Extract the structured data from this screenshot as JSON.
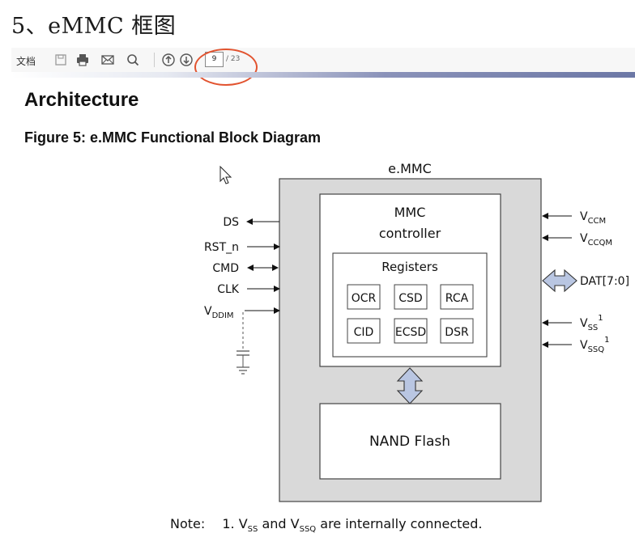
{
  "heading": "5、eMMC 框图",
  "toolbar": {
    "doc_label": "文档",
    "page_current": "9",
    "page_total": "/ 23",
    "icons": [
      "save-icon",
      "print-icon",
      "mail-icon",
      "search-icon",
      "arrow-up-circle-icon",
      "arrow-down-circle-icon"
    ]
  },
  "document": {
    "section_title": "Architecture",
    "figure_title": "Figure 5: e.MMC Functional Block Diagram",
    "diagram": {
      "outer_label": "e.MMC",
      "controller_line1": "MMC",
      "controller_line2": "controller",
      "registers_label": "Registers",
      "registers": [
        "OCR",
        "CSD",
        "RCA",
        "CID",
        "ECSD",
        "DSR"
      ],
      "nand_label": "NAND Flash",
      "left_signals": {
        "ds": "DS",
        "rst": "RST_n",
        "cmd": "CMD",
        "clk": "CLK",
        "vddim_main": "V",
        "vddim_sub": "DDIM"
      },
      "right_signals": {
        "vccm_main": "V",
        "vccm_sub": "CCM",
        "vccqm_main": "V",
        "vccqm_sub": "CCQM",
        "dat": "DAT[7:0]",
        "vss_main": "V",
        "vss_sub": "SS",
        "vss_sup": "1",
        "vssq_main": "V",
        "vssq_sub": "SSQ",
        "vssq_sup": "1"
      }
    },
    "note": {
      "label": "Note:",
      "num": "1.",
      "v1": "V",
      "v1_sub": "SS",
      "mid": " and ",
      "v2": "V",
      "v2_sub": "SSQ",
      "end": " are internally connected."
    }
  },
  "colors": {
    "outer_fill": "#d9d9d9",
    "arrow_fill": "#b9c6e2",
    "annotation_circle": "#e2532f"
  }
}
